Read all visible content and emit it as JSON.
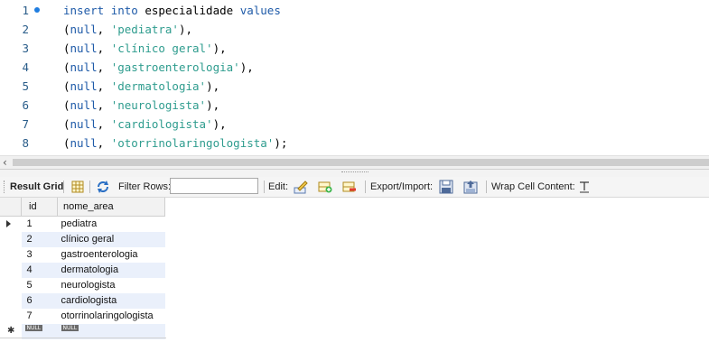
{
  "editor": {
    "lines": [
      {
        "n": "1",
        "tokens": [
          [
            "kw",
            "insert"
          ],
          [
            "p",
            " "
          ],
          [
            "kw",
            "into"
          ],
          [
            "p",
            " especialidade "
          ],
          [
            "kw",
            "values"
          ]
        ]
      },
      {
        "n": "2",
        "tokens": [
          [
            "p",
            "("
          ],
          [
            "kw",
            "null"
          ],
          [
            "p",
            ", "
          ],
          [
            "str",
            "'pediatra'"
          ],
          [
            "p",
            "),"
          ]
        ]
      },
      {
        "n": "3",
        "tokens": [
          [
            "p",
            "("
          ],
          [
            "kw",
            "null"
          ],
          [
            "p",
            ", "
          ],
          [
            "str",
            "'clínico geral'"
          ],
          [
            "p",
            "),"
          ]
        ]
      },
      {
        "n": "4",
        "tokens": [
          [
            "p",
            "("
          ],
          [
            "kw",
            "null"
          ],
          [
            "p",
            ", "
          ],
          [
            "str",
            "'gastroenterologia'"
          ],
          [
            "p",
            "),"
          ]
        ]
      },
      {
        "n": "5",
        "tokens": [
          [
            "p",
            "("
          ],
          [
            "kw",
            "null"
          ],
          [
            "p",
            ", "
          ],
          [
            "str",
            "'dermatologia'"
          ],
          [
            "p",
            "),"
          ]
        ]
      },
      {
        "n": "6",
        "tokens": [
          [
            "p",
            "("
          ],
          [
            "kw",
            "null"
          ],
          [
            "p",
            ", "
          ],
          [
            "str",
            "'neurologista'"
          ],
          [
            "p",
            "),"
          ]
        ]
      },
      {
        "n": "7",
        "tokens": [
          [
            "p",
            "("
          ],
          [
            "kw",
            "null"
          ],
          [
            "p",
            ", "
          ],
          [
            "str",
            "'cardiologista'"
          ],
          [
            "p",
            "),"
          ]
        ]
      },
      {
        "n": "8",
        "tokens": [
          [
            "p",
            "("
          ],
          [
            "kw",
            "null"
          ],
          [
            "p",
            ", "
          ],
          [
            "str",
            "'otorrinolaringologista'"
          ],
          [
            "p",
            ");"
          ]
        ]
      }
    ]
  },
  "toolbar": {
    "result_grid_label": "Result Grid",
    "filter_rows_label": "Filter Rows:",
    "filter_value": "",
    "edit_label": "Edit:",
    "export_import_label": "Export/Import:",
    "wrap_cell_label": "Wrap Cell Content:"
  },
  "grid": {
    "columns": [
      "id",
      "nome_area"
    ],
    "rows": [
      [
        "1",
        "pediatra"
      ],
      [
        "2",
        "clínico geral"
      ],
      [
        "3",
        "gastroenterologia"
      ],
      [
        "4",
        "dermatologia"
      ],
      [
        "5",
        "neurologista"
      ],
      [
        "6",
        "cardiologista"
      ],
      [
        "7",
        "otorrinolaringologista"
      ]
    ],
    "new_row": [
      "NULL",
      "NULL"
    ]
  },
  "colors": {
    "keyword": "#1e5aa8",
    "string": "#2e9c8e",
    "line_number": "#2a5d8a",
    "alt_row": "#eaf0fb"
  }
}
